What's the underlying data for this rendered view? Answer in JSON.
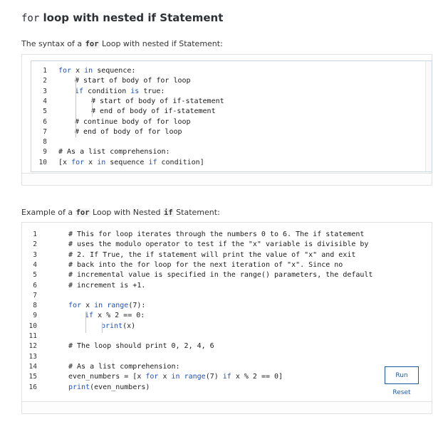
{
  "heading": {
    "code": "for",
    "text": " loop with nested if Statement"
  },
  "syntax_intro": {
    "prefix": "The syntax of a ",
    "code": "for",
    "suffix": " Loop with nested if Statement:"
  },
  "syntax_code": {
    "lines": [
      {
        "n": "1",
        "indent": 0,
        "tokens": [
          [
            "kw",
            "for"
          ],
          [
            "",
            "x "
          ],
          [
            "kw",
            "in"
          ],
          [
            "",
            "sequence:"
          ]
        ]
      },
      {
        "n": "2",
        "indent": 1,
        "tokens": [
          [
            "cm",
            "# start of body of for loop"
          ]
        ]
      },
      {
        "n": "3",
        "indent": 1,
        "tokens": [
          [
            "kw",
            "if"
          ],
          [
            "",
            "condition "
          ],
          [
            "kw",
            "is"
          ],
          [
            "",
            "true:"
          ]
        ]
      },
      {
        "n": "4",
        "indent": 2,
        "tokens": [
          [
            "cm",
            "# start of body of if-statement"
          ]
        ]
      },
      {
        "n": "5",
        "indent": 2,
        "tokens": [
          [
            "cm",
            "# end of body of if-statement"
          ]
        ]
      },
      {
        "n": "6",
        "indent": 1,
        "tokens": [
          [
            "cm",
            "# continue body of for loop"
          ]
        ]
      },
      {
        "n": "7",
        "indent": 1,
        "tokens": [
          [
            "cm",
            "# end of body of for loop"
          ]
        ]
      },
      {
        "n": "8",
        "indent": 0,
        "tokens": []
      },
      {
        "n": "9",
        "indent": 0,
        "tokens": [
          [
            "cm",
            "# As a list comprehension:"
          ]
        ]
      },
      {
        "n": "10",
        "indent": 0,
        "tokens": [
          [
            "",
            "[x "
          ],
          [
            "kw",
            "for"
          ],
          [
            "",
            "x "
          ],
          [
            "kw",
            "in"
          ],
          [
            "",
            "sequence "
          ],
          [
            "kw",
            "if"
          ],
          [
            "",
            "condition]"
          ]
        ]
      }
    ]
  },
  "example_intro": {
    "prefix": "Example of a ",
    "code1": "for",
    "middle": " Loop with Nested ",
    "code2": "if",
    "suffix": " Statement:"
  },
  "example_code": {
    "lines": [
      {
        "n": "1",
        "indent": 0,
        "tokens": [
          [
            "cm",
            "# This for loop iterates through the numbers 0 to 6. The if statement"
          ]
        ]
      },
      {
        "n": "2",
        "indent": 0,
        "tokens": [
          [
            "cm",
            "# uses the modulo operator to test if the \"x\" variable is divisible by"
          ]
        ]
      },
      {
        "n": "3",
        "indent": 0,
        "tokens": [
          [
            "cm",
            "# 2. If True, the if statement will print the value of \"x\" and exit"
          ]
        ]
      },
      {
        "n": "4",
        "indent": 0,
        "tokens": [
          [
            "cm",
            "# back into the for loop for the next iteration of \"x\". Since no"
          ]
        ]
      },
      {
        "n": "5",
        "indent": 0,
        "tokens": [
          [
            "cm",
            "# incremental value is specified in the range() parameters, the default"
          ]
        ]
      },
      {
        "n": "6",
        "indent": 0,
        "tokens": [
          [
            "cm",
            "# increment is +1."
          ]
        ]
      },
      {
        "n": "7",
        "indent": 0,
        "tokens": []
      },
      {
        "n": "8",
        "indent": 0,
        "tokens": [
          [
            "kw",
            "for"
          ],
          [
            "",
            "x "
          ],
          [
            "kw",
            "in"
          ],
          [
            "kw",
            "range"
          ],
          [
            "",
            "(7):"
          ]
        ]
      },
      {
        "n": "9",
        "indent": 1,
        "tokens": [
          [
            "kw",
            "if"
          ],
          [
            "",
            "x % 2 == 0:"
          ]
        ]
      },
      {
        "n": "10",
        "indent": 2,
        "tokens": [
          [
            "kw",
            "print"
          ],
          [
            "",
            "(x)"
          ]
        ]
      },
      {
        "n": "11",
        "indent": 0,
        "tokens": []
      },
      {
        "n": "12",
        "indent": 0,
        "tokens": [
          [
            "cm",
            "# The loop should print 0, 2, 4, 6"
          ]
        ]
      },
      {
        "n": "13",
        "indent": 0,
        "tokens": []
      },
      {
        "n": "14",
        "indent": 0,
        "tokens": [
          [
            "cm",
            "# As a list comprehension:"
          ]
        ]
      },
      {
        "n": "15",
        "indent": 0,
        "tokens": [
          [
            "",
            "even_numbers = [x "
          ],
          [
            "kw",
            "for"
          ],
          [
            "",
            "x "
          ],
          [
            "kw",
            "in"
          ],
          [
            "kw",
            "range"
          ],
          [
            "",
            "(7) "
          ],
          [
            "kw",
            "if"
          ],
          [
            "",
            "x % 2 == 0]"
          ]
        ]
      },
      {
        "n": "16",
        "indent": 0,
        "tokens": [
          [
            "kw",
            "print"
          ],
          [
            "",
            "(even_numbers)"
          ]
        ]
      }
    ]
  },
  "buttons": {
    "run_label": "Run",
    "reset_label": "Reset"
  },
  "colors": {
    "keyword": "#1f4fb5",
    "button_accent": "#1f5a9e",
    "border": "#e2e2e2"
  }
}
